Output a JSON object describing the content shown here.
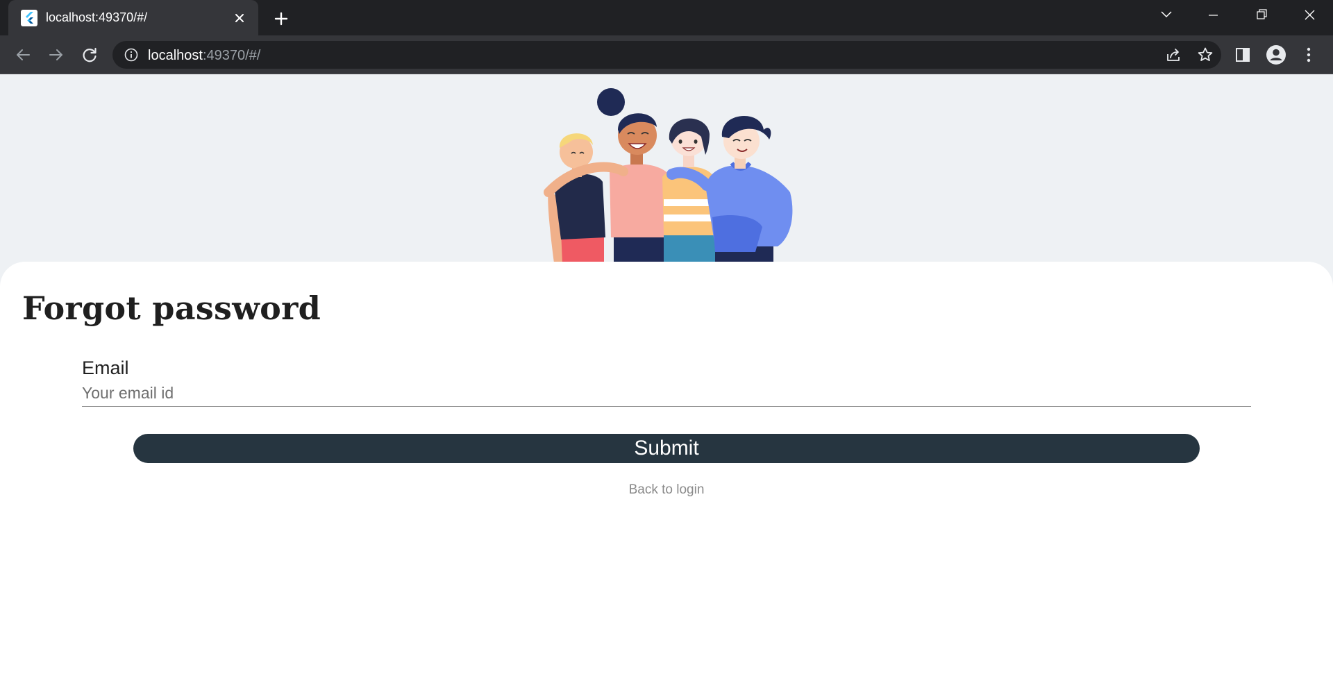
{
  "browser": {
    "tab_title": "localhost:49370/#/",
    "url_host": "localhost",
    "url_rest": ":49370/#/"
  },
  "page": {
    "title": "Forgot password",
    "email_label": "Email",
    "email_placeholder": "Your email id",
    "email_value": "",
    "submit_label": "Submit",
    "back_link": "Back to login"
  },
  "colors": {
    "hero_background": "#eef1f4",
    "button_background": "#263540",
    "chrome_background": "#202124"
  },
  "icons": {
    "tab": [
      "flutter-favicon-icon",
      "close-icon",
      "plus-icon"
    ],
    "window": [
      "chevron-down-icon",
      "minimize-icon",
      "restore-icon",
      "close-icon"
    ],
    "toolbar": [
      "back-arrow-icon",
      "forward-arrow-icon",
      "reload-icon",
      "info-icon",
      "share-icon",
      "star-icon",
      "side-panel-icon",
      "profile-icon",
      "kebab-menu-icon"
    ]
  }
}
